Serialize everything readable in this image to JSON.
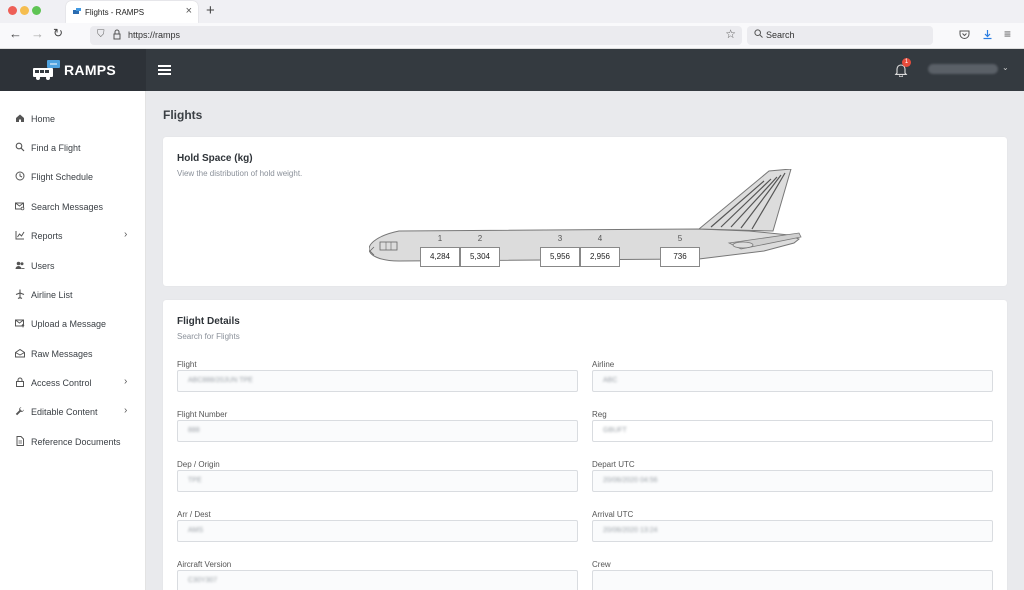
{
  "browser": {
    "tab_title": "Flights - RAMPS",
    "url": "https://ramps",
    "search_placeholder": "Search"
  },
  "app": {
    "name": "RAMPS",
    "notification_count": "1",
    "brand_color": "#343a40"
  },
  "sidebar": {
    "items": [
      {
        "label": "Home",
        "icon": "home-icon",
        "has_submenu": false
      },
      {
        "label": "Find a Flight",
        "icon": "search-icon",
        "has_submenu": false
      },
      {
        "label": "Flight Schedule",
        "icon": "clock-icon",
        "has_submenu": false
      },
      {
        "label": "Search Messages",
        "icon": "mail-search-icon",
        "has_submenu": false
      },
      {
        "label": "Reports",
        "icon": "chart-line-icon",
        "has_submenu": true
      },
      {
        "label": "Users",
        "icon": "users-icon",
        "has_submenu": false
      },
      {
        "label": "Airline List",
        "icon": "plane-icon",
        "has_submenu": false
      },
      {
        "label": "Upload a Message",
        "icon": "upload-mail-icon",
        "has_submenu": false
      },
      {
        "label": "Raw Messages",
        "icon": "envelope-open-icon",
        "has_submenu": false
      },
      {
        "label": "Access Control",
        "icon": "lock-icon",
        "has_submenu": true
      },
      {
        "label": "Editable Content",
        "icon": "wrench-icon",
        "has_submenu": true
      },
      {
        "label": "Reference Documents",
        "icon": "document-icon",
        "has_submenu": false
      }
    ]
  },
  "page": {
    "title": "Flights"
  },
  "hold_space": {
    "title": "Hold Space (kg)",
    "subtitle": "View the distribution of hold weight.",
    "holds": [
      {
        "number": "1",
        "weight": "4,284"
      },
      {
        "number": "2",
        "weight": "5,304"
      },
      {
        "number": "3",
        "weight": "5,956"
      },
      {
        "number": "4",
        "weight": "2,956"
      },
      {
        "number": "5",
        "weight": "736"
      }
    ]
  },
  "flight_details": {
    "title": "Flight Details",
    "subtitle": "Search for Flights",
    "fields": {
      "flight": {
        "label": "Flight",
        "value": "ABC888/20JUN TPE"
      },
      "airline": {
        "label": "Airline",
        "value": "ABC"
      },
      "flight_number": {
        "label": "Flight Number",
        "value": "888"
      },
      "reg": {
        "label": "Reg",
        "value": "GBUFT"
      },
      "dep_origin": {
        "label": "Dep / Origin",
        "value": "TPE"
      },
      "depart_utc": {
        "label": "Depart UTC",
        "value": "20/06/2020 04:56"
      },
      "arr_dest": {
        "label": "Arr / Dest",
        "value": "AMS"
      },
      "arrival_utc": {
        "label": "Arrival UTC",
        "value": "20/06/2020 13:24"
      },
      "aircraft_version": {
        "label": "Aircraft Version",
        "value": "C30Y307"
      },
      "crew": {
        "label": "Crew",
        "value": ""
      }
    }
  }
}
